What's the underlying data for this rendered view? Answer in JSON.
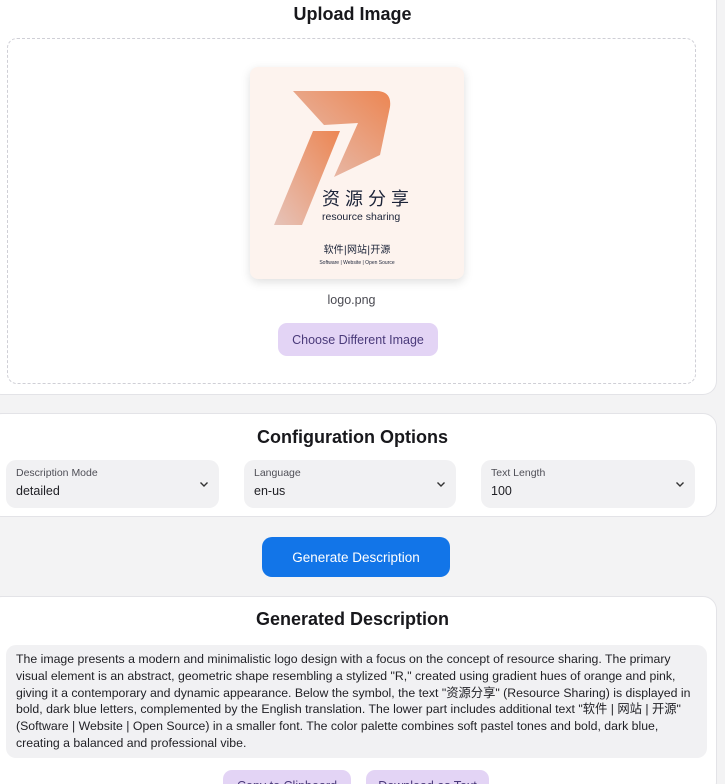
{
  "upload": {
    "title": "Upload Image",
    "preview": {
      "logo_cn": "资源分享",
      "logo_en": "resource sharing",
      "logo_cn2": "软件|网站|开源",
      "logo_en2": "Software | Website | Open Source"
    },
    "filename": "logo.png",
    "choose_label": "Choose Different Image"
  },
  "config": {
    "title": "Configuration Options",
    "mode": {
      "label": "Description Mode",
      "value": "detailed"
    },
    "language": {
      "label": "Language",
      "value": "en-us"
    },
    "length": {
      "label": "Text Length",
      "value": "100"
    }
  },
  "generate_label": "Generate Description",
  "result": {
    "title": "Generated Description",
    "text": "The image presents a modern and minimalistic logo design with a focus on the concept of resource sharing. The primary visual element is an abstract, geometric shape resembling a stylized \"R,\" created using gradient hues of orange and pink, giving it a contemporary and dynamic appearance. Below the symbol, the text \"资源分享\" (Resource Sharing) is displayed in bold, dark blue letters, complemented by the English translation. The lower part includes additional text \"软件 | 网站 | 开源\" (Software | Website | Open Source) in a smaller font. The color palette combines soft pastel tones and bold, dark blue, creating a balanced and professional vibe.",
    "copy_label": "Copy to Clipboard",
    "download_label": "Download as Text"
  },
  "colors": {
    "primary": "#1275e8",
    "secondary_bg": "#e3d4f5",
    "secondary_text": "#4a3a7a",
    "logo_gradient_start": "#e8c0b4",
    "logo_gradient_end": "#ec8a5a",
    "logo_text": "#1b2338"
  }
}
